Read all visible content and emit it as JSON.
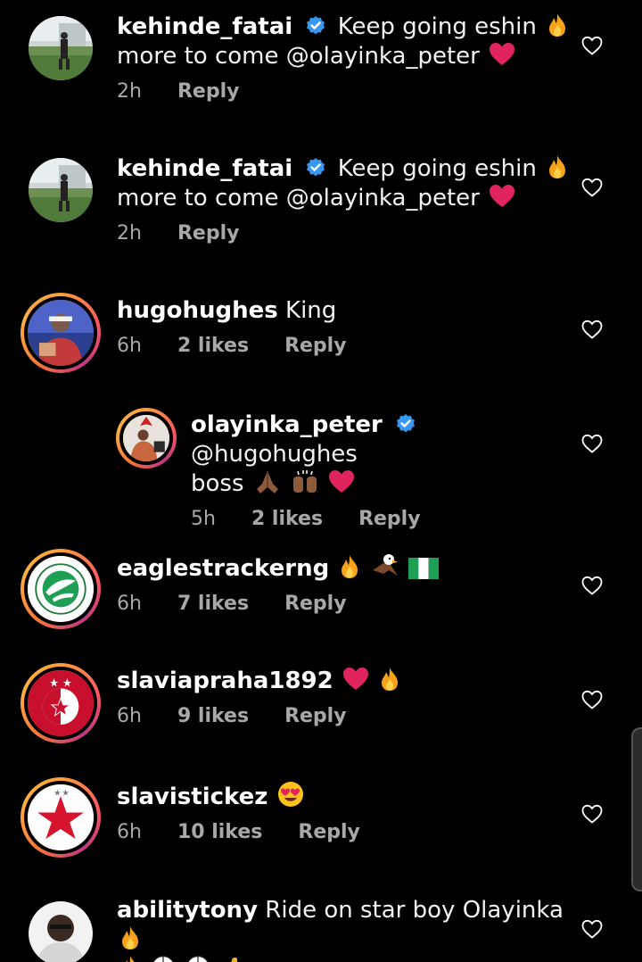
{
  "comments": [
    {
      "username": "kehinde_fatai",
      "verified": true,
      "text": "Keep going eshin",
      "text2": "more to come @olayinka_peter",
      "time": "2h",
      "likes": "",
      "reply": "Reply"
    },
    {
      "username": "kehinde_fatai",
      "verified": true,
      "text": "Keep going eshin",
      "text2": "more to come @olayinka_peter",
      "time": "2h",
      "likes": "",
      "reply": "Reply"
    },
    {
      "username": "hugohughes",
      "text": "King",
      "time": "6h",
      "likes": "2 likes",
      "reply": "Reply"
    },
    {
      "username": "olayinka_peter",
      "verified": true,
      "text": "@hugohughes",
      "text2": "boss",
      "time": "5h",
      "likes": "2 likes",
      "reply": "Reply"
    },
    {
      "username": "eaglestrackerng",
      "text": "",
      "time": "6h",
      "likes": "7 likes",
      "reply": "Reply"
    },
    {
      "username": "slaviapraha1892",
      "text": "",
      "time": "6h",
      "likes": "9 likes",
      "reply": "Reply"
    },
    {
      "username": "slavistickez",
      "text": "",
      "time": "6h",
      "likes": "10 likes",
      "reply": "Reply"
    },
    {
      "username": "abilitytony",
      "text": "Ride on star boy Olayinka",
      "time": "",
      "likes": "",
      "reply": ""
    }
  ],
  "colors": {
    "background": "#000000",
    "meta": "#a8a8a8",
    "verified": "#3897f0",
    "heart_emoji": "#e0245e"
  }
}
